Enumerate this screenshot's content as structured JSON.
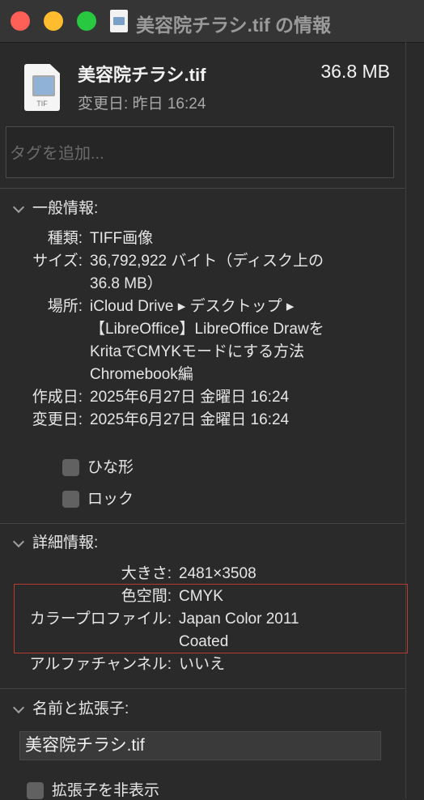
{
  "window": {
    "title": "美容院チラシ.tif の情報"
  },
  "file": {
    "name": "美容院チラシ.tif",
    "size": "36.8 MB",
    "modified_label": "変更日:",
    "modified_value": "昨日 16:24",
    "icon_ext": "TIF"
  },
  "tags": {
    "placeholder": "タグを追加..."
  },
  "general": {
    "header": "一般情報:",
    "kind_label": "種類:",
    "kind_value": "TIFF画像",
    "size_label": "サイズ:",
    "size_line1": "36,792,922 バイト（ディスク上の",
    "size_line2": "36.8 MB）",
    "where_label": "場所:",
    "where_line1": "iCloud Drive ▸ デスクトップ ▸",
    "where_line2": "【LibreOffice】LibreOffice Drawを",
    "where_line3": "KritaでCMYKモードにする方法",
    "where_line4": "Chromebook編",
    "created_label": "作成日:",
    "created_value": "2025年6月27日 金曜日 16:24",
    "modified_label": "変更日:",
    "modified_value": "2025年6月27日 金曜日 16:24",
    "stationery_label": "ひな形",
    "locked_label": "ロック"
  },
  "more_info": {
    "header": "詳細情報:",
    "dimensions_label": "大きさ:",
    "dimensions_value": "2481×3508",
    "color_space_label": "色空間:",
    "color_space_value": "CMYK",
    "color_profile_label": "カラープロファイル:",
    "color_profile_line1": "Japan Color 2011",
    "color_profile_line2": "Coated",
    "alpha_label": "アルファチャンネル:",
    "alpha_value": "いいえ"
  },
  "name_ext": {
    "header": "名前と拡張子:",
    "name_value": "美容院チラシ.tif",
    "hide_ext_label": "拡張子を非表示"
  },
  "colors": {
    "highlight": "#b83a2e",
    "close": "#fe5f57",
    "minimize": "#febc2e",
    "zoom": "#28c840"
  },
  "icons": [
    "close-button",
    "minimize-button",
    "zoom-button",
    "tif-file-icon",
    "chevron-down-icon",
    "checkbox"
  ]
}
